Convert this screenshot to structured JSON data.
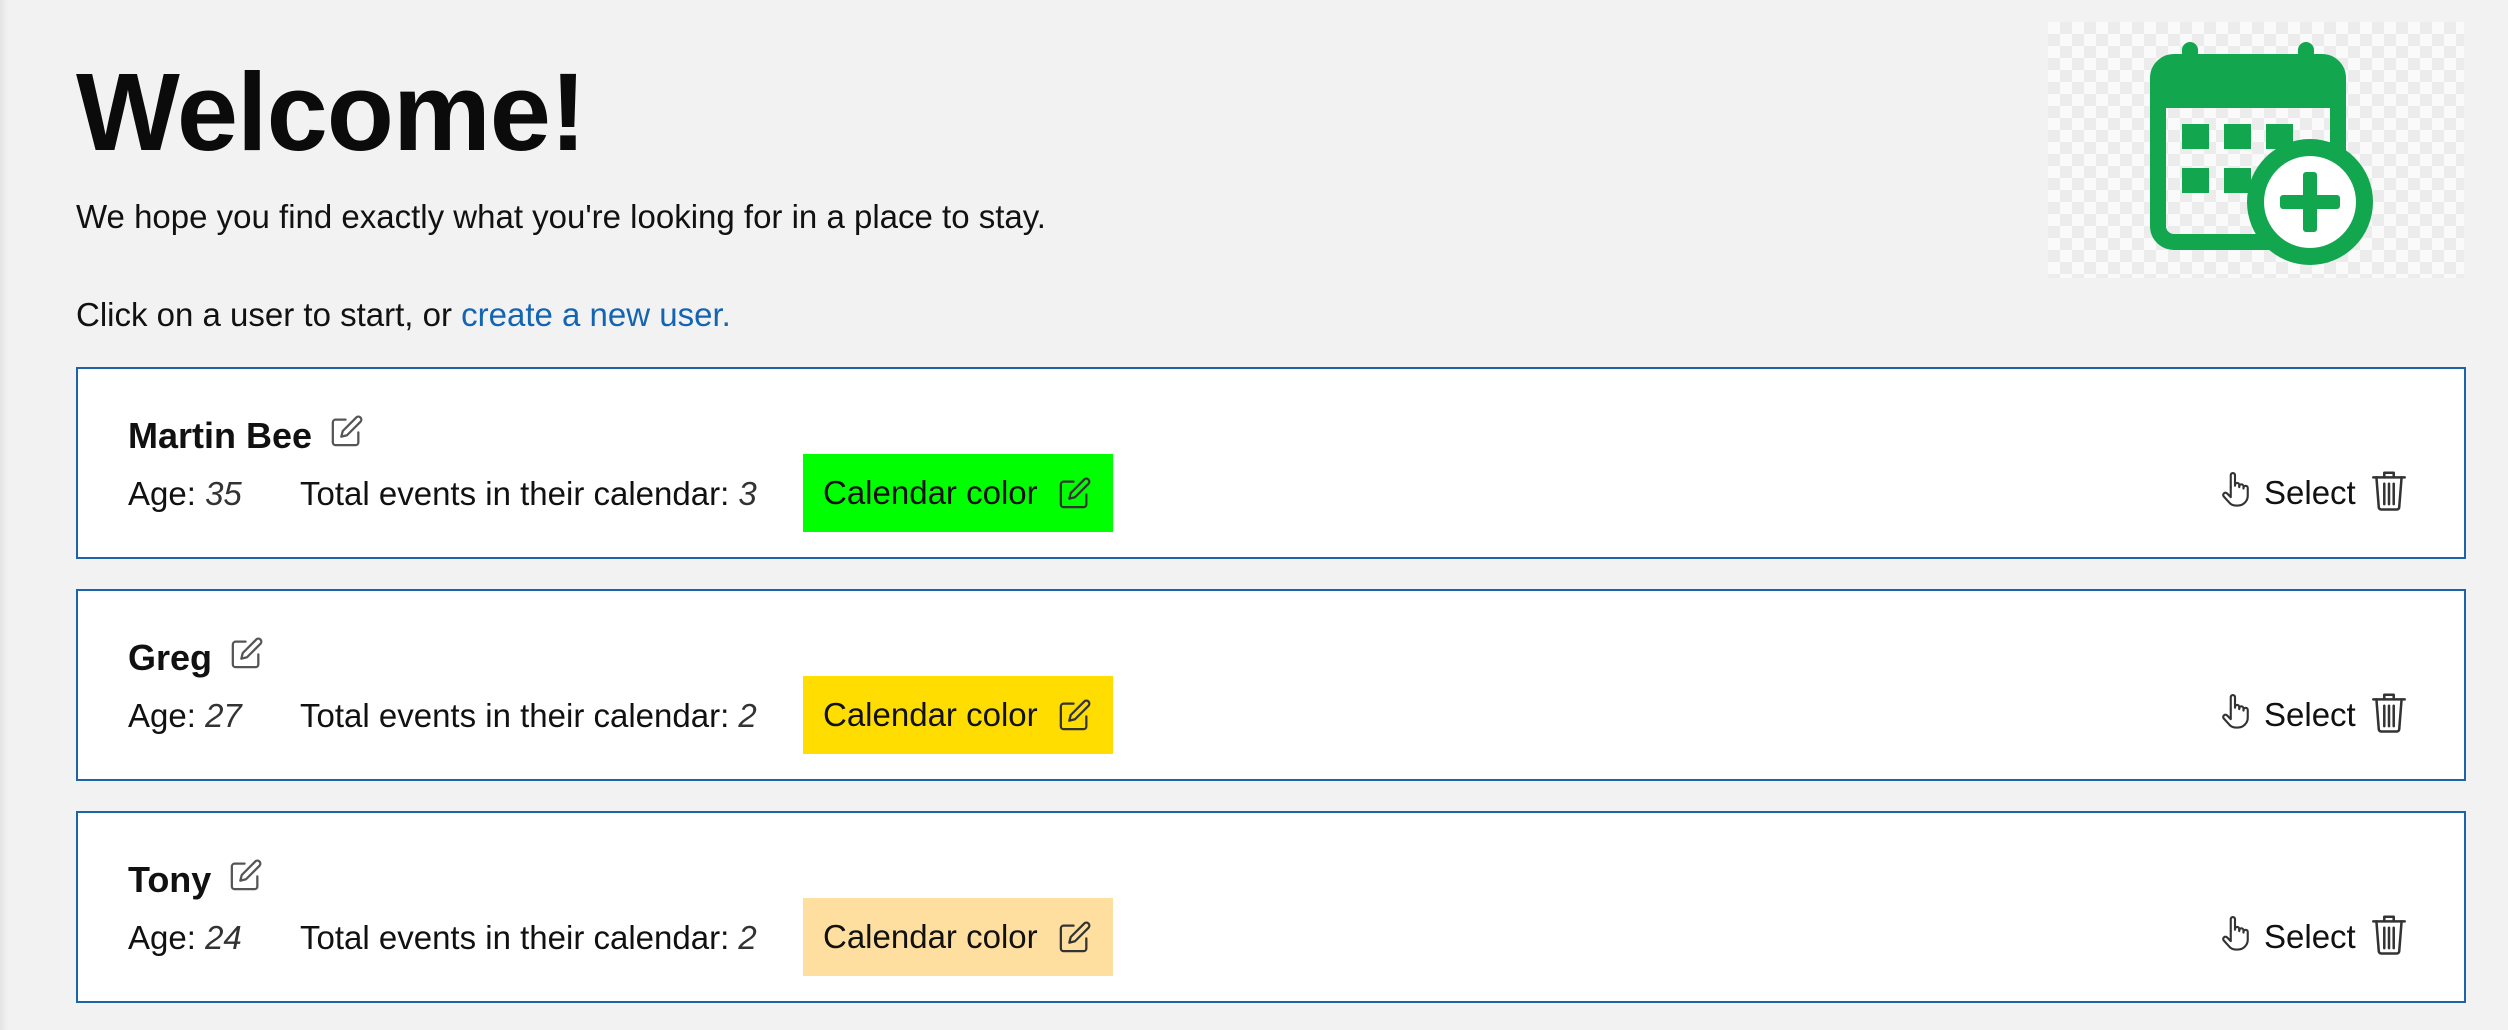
{
  "header": {
    "title": "Welcome!",
    "subtitle": "We hope you find exactly what you're looking for in a place to stay.",
    "intro_text": "Click on a user to start, or ",
    "create_link": "create a new user.",
    "logo_icon": "calendar-plus-icon",
    "logo_color": "#12a64f"
  },
  "labels": {
    "age": "Age:",
    "events": "Total events in their calendar:",
    "calendar_color": "Calendar color",
    "select": "Select"
  },
  "users": [
    {
      "name": "Martin Bee",
      "age": "35",
      "events": "3",
      "color": "#00ff00"
    },
    {
      "name": "Greg",
      "age": "27",
      "events": "2",
      "color": "#ffdd00"
    },
    {
      "name": "Tony",
      "age": "24",
      "events": "2",
      "color": "#ffdfa0"
    }
  ],
  "icons": {
    "name_edit": "edit-icon",
    "color_edit": "edit-icon",
    "select": "hand-pointer-icon",
    "delete": "trash-icon"
  }
}
